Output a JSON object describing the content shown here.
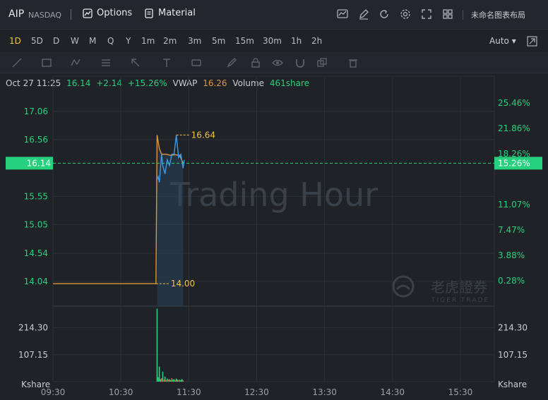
{
  "header": {
    "symbol": "AIP",
    "exchange": "NASDAQ",
    "options_label": "Options",
    "material_label": "Material",
    "layout_name": "未命名图表布局"
  },
  "periods": [
    "1D",
    "5D",
    "D",
    "W",
    "M",
    "Q",
    "Y",
    "1m",
    "2m",
    "3m",
    "5m",
    "15m",
    "30m",
    "1h",
    "2h"
  ],
  "active_period": "1D",
  "scale_mode": "Auto",
  "info": {
    "datetime": "Oct 27 11:25",
    "price": "16.14",
    "change": "+2.14",
    "change_pct": "+15.26%",
    "vwap_label": "VWAP",
    "vwap": "16.26",
    "volume_label": "Volume",
    "volume": "461share"
  },
  "colors": {
    "up": "#26d07c",
    "price_line": "#e0953a",
    "vwap_line": "#3d9ae8",
    "highlight": "#f0c24b",
    "grid": "#2c3137"
  },
  "watermark": "Trading Hour",
  "brand": {
    "cn": "老虎證券",
    "en": "TIGER TRADE"
  },
  "chart_data": {
    "type": "line",
    "x_ticks": [
      "09:30",
      "10:30",
      "11:30",
      "12:30",
      "13:30",
      "14:30",
      "15:30"
    ],
    "y_ticks_price": [
      "17.06",
      "16.56",
      "15.55",
      "15.05",
      "14.54",
      "14.04"
    ],
    "y_ticks_pct": [
      "25.46%",
      "21.86%",
      "18.26%",
      "11.07%",
      "7.47%",
      "3.88%",
      "0.28%"
    ],
    "ylim": [
      13.6,
      17.46
    ],
    "prev_close": 14.0,
    "current_price": 16.14,
    "current_pct": "15.26%",
    "high_label": "16.64",
    "low_label": "14.00",
    "price_series": {
      "name": "Price",
      "points": [
        [
          "09:30",
          14.0
        ],
        [
          "11:01",
          14.0
        ],
        [
          "11:02",
          16.64
        ],
        [
          "11:04",
          16.4
        ],
        [
          "11:06",
          16.3
        ],
        [
          "11:10",
          16.3
        ],
        [
          "11:14",
          16.28
        ],
        [
          "11:18",
          16.29
        ],
        [
          "11:22",
          16.28
        ],
        [
          "11:25",
          16.14
        ]
      ]
    },
    "vwap_series": {
      "name": "VWAP",
      "points": [
        [
          "11:02",
          15.85
        ],
        [
          "11:03",
          15.9
        ],
        [
          "11:04",
          15.8
        ],
        [
          "11:06",
          16.3
        ],
        [
          "11:07",
          16.1
        ],
        [
          "11:09",
          15.95
        ],
        [
          "11:11",
          16.2
        ],
        [
          "11:13",
          16.1
        ],
        [
          "11:15",
          16.3
        ],
        [
          "11:17",
          16.3
        ],
        [
          "11:19",
          16.64
        ],
        [
          "11:21",
          16.24
        ],
        [
          "11:23",
          16.3
        ],
        [
          "11:25",
          16.05
        ],
        [
          "11:26",
          16.2
        ]
      ]
    },
    "volume": {
      "unit": "Kshare",
      "y_ticks": [
        "214.30",
        "107.15"
      ],
      "ylim": [
        0,
        300
      ],
      "bars": [
        [
          "11:02",
          290,
          "up"
        ],
        [
          "11:03",
          18,
          "up"
        ],
        [
          "11:04",
          60,
          "up"
        ],
        [
          "11:05",
          10,
          "up"
        ],
        [
          "11:06",
          14,
          "down"
        ],
        [
          "11:07",
          40,
          "up"
        ],
        [
          "11:08",
          8,
          "down"
        ],
        [
          "11:09",
          20,
          "up"
        ],
        [
          "11:10",
          6,
          "down"
        ],
        [
          "11:11",
          12,
          "up"
        ],
        [
          "11:12",
          8,
          "down"
        ],
        [
          "11:13",
          10,
          "up"
        ],
        [
          "11:14",
          6,
          "up"
        ],
        [
          "11:15",
          14,
          "down"
        ],
        [
          "11:16",
          8,
          "up"
        ],
        [
          "11:17",
          10,
          "up"
        ],
        [
          "11:18",
          6,
          "down"
        ],
        [
          "11:19",
          12,
          "up"
        ],
        [
          "11:20",
          8,
          "up"
        ],
        [
          "11:21",
          6,
          "down"
        ],
        [
          "11:22",
          8,
          "up"
        ],
        [
          "11:23",
          6,
          "up"
        ],
        [
          "11:24",
          10,
          "up"
        ],
        [
          "11:25",
          6,
          "down"
        ]
      ]
    }
  }
}
